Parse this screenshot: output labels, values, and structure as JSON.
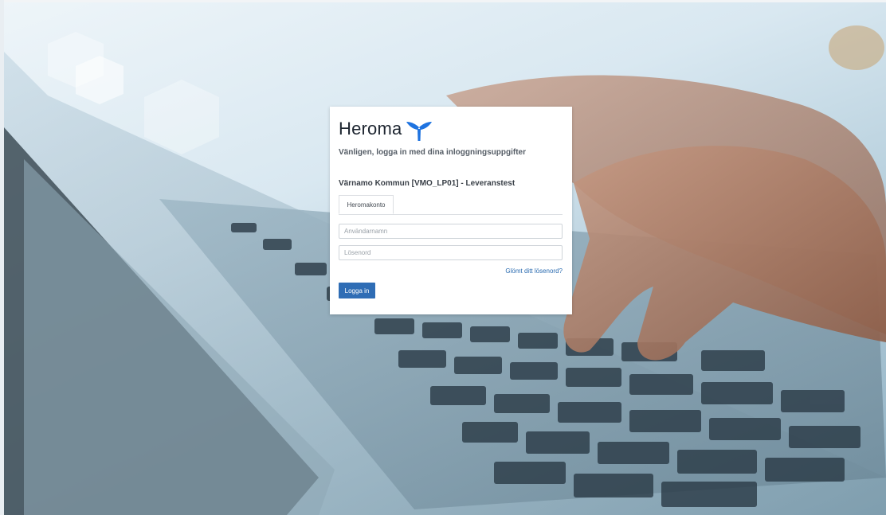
{
  "brand": {
    "name": "Heroma",
    "accent_color": "#1e73e0"
  },
  "login": {
    "subtitle": "Vänligen, logga in med dina inloggningsuppgifter",
    "organization": "Värnamo Kommun [VMO_LP01] - Leveranstest",
    "tabs": [
      {
        "label": "Heromakonto",
        "active": true
      }
    ],
    "username_placeholder": "Användarnamn",
    "username_value": "",
    "password_placeholder": "Lösenord",
    "password_value": "",
    "forgot_link": "Glömt ditt lösenord?",
    "submit_label": "Logga in",
    "submit_color": "#2f6db5"
  },
  "icons": {
    "logo_mark": "heroma-y-logo-icon"
  }
}
